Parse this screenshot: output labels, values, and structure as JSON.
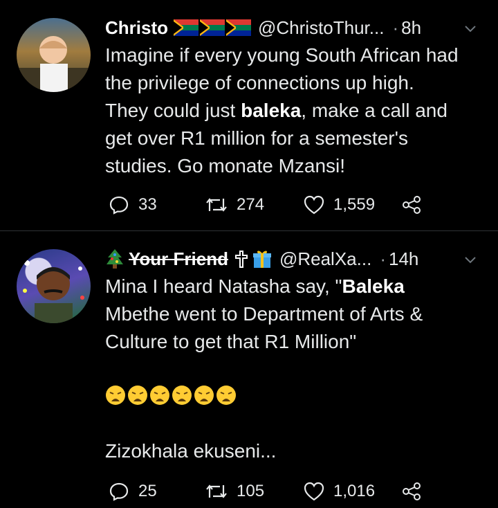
{
  "tweets": [
    {
      "name": "Christo",
      "flag_count": 3,
      "handle": "@ChristoThur...",
      "dot": "·",
      "time": "8h",
      "text_parts": [
        "Imagine if every young South African had\nthe privilege of connections up high.\nThey could just ",
        "baleka",
        ", make a call and\nget over R1 million for a semester's\nstudies. Go monate Mzansi!"
      ],
      "replies": "33",
      "retweets": "274",
      "likes": "1,559"
    },
    {
      "name": "Your Friend",
      "name_prefix_icon": "christmas-tree-icon",
      "name_suffix_icons": [
        "cross-icon",
        "gift-icon"
      ],
      "handle": "@RealXa...",
      "dot": "·",
      "time": "14h",
      "text_parts": [
        "Mina I heard Natasha say, \"",
        "Baleka",
        "\nMbethe went to Department of Arts &\nCulture to get that R1 Million\""
      ],
      "emoji_count": 6,
      "emoji_name": "weary-face",
      "closing_line": "Zizokhala ekuseni...",
      "replies": "25",
      "retweets": "105",
      "likes": "1,016"
    }
  ],
  "colors": {
    "background": "#000000",
    "text": "#e7e9ea",
    "muted": "#9ea3a8",
    "divider": "#2f3336"
  }
}
